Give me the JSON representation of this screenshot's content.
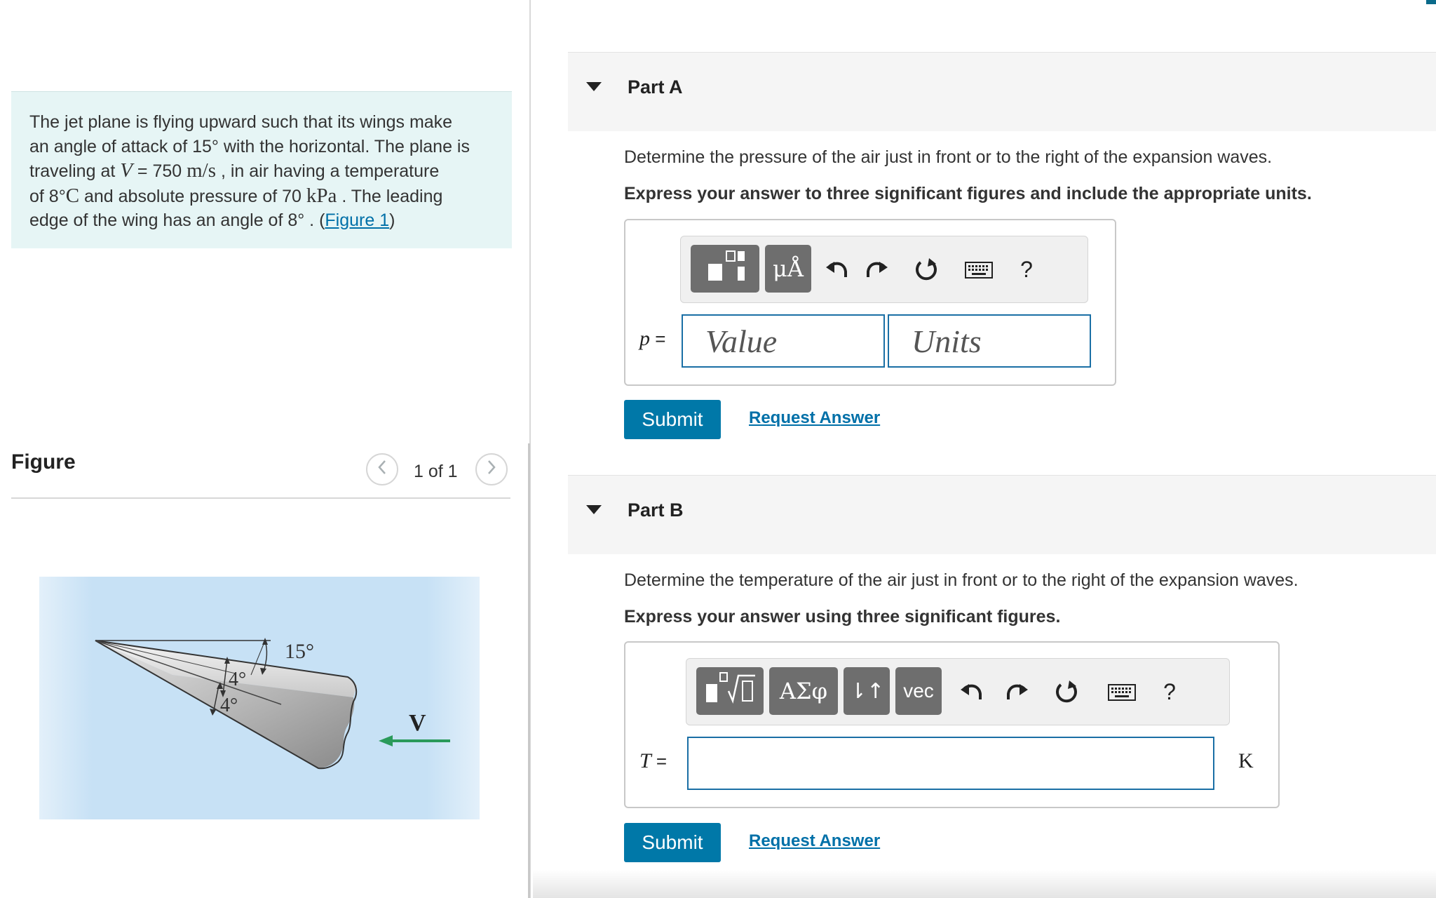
{
  "problem": {
    "line1": "The jet plane is flying upward such that its wings make",
    "line2": "an angle of attack of 15° with the horizontal. The plane is",
    "line3_a": "traveling at ",
    "line3_V": "V",
    "line3_b": " = 750 ",
    "line3_unit": "m/s",
    "line3_c": " , in air having a temperature",
    "line4_a": "of 8°",
    "line4_C": "C",
    "line4_b": " and absolute pressure of 70 ",
    "line4_unit": "kPa",
    "line4_c": " . The leading",
    "line5_a": "edge of the wing has an angle of 8° . (",
    "line5_link": "Figure 1",
    "line5_b": ")"
  },
  "figure": {
    "title": "Figure",
    "counter": "1 of 1",
    "prev": "<",
    "next": ">",
    "label_15": "15°",
    "label_4a": "4°",
    "label_4b": "4°",
    "label_V": "V"
  },
  "partA": {
    "title": "Part A",
    "question": "Determine the pressure of the air just in front or to the right of the expansion waves.",
    "instruction": "Express your answer to three significant figures and include the appropriate units.",
    "var": "p",
    "eq": " =",
    "value_placeholder": "Value",
    "units_placeholder": "Units",
    "tool_units": "μÅ",
    "help": "?",
    "submit": "Submit",
    "request": "Request Answer"
  },
  "partB": {
    "title": "Part B",
    "question": "Determine the temperature of the air just in front or to the right of the expansion waves.",
    "instruction": "Express your answer using three significant figures.",
    "var": "T",
    "eq": " =",
    "unit": "K",
    "tool_greek": "ΑΣφ",
    "tool_arrows": "⇂↑",
    "tool_vec": "vec",
    "help": "?",
    "submit": "Submit",
    "request": "Request Answer"
  },
  "colors": {
    "accent": "#0078a8",
    "link": "#0070a8",
    "problem_bg": "#e6f5f5",
    "figure_bg": "#cfe6f5"
  }
}
